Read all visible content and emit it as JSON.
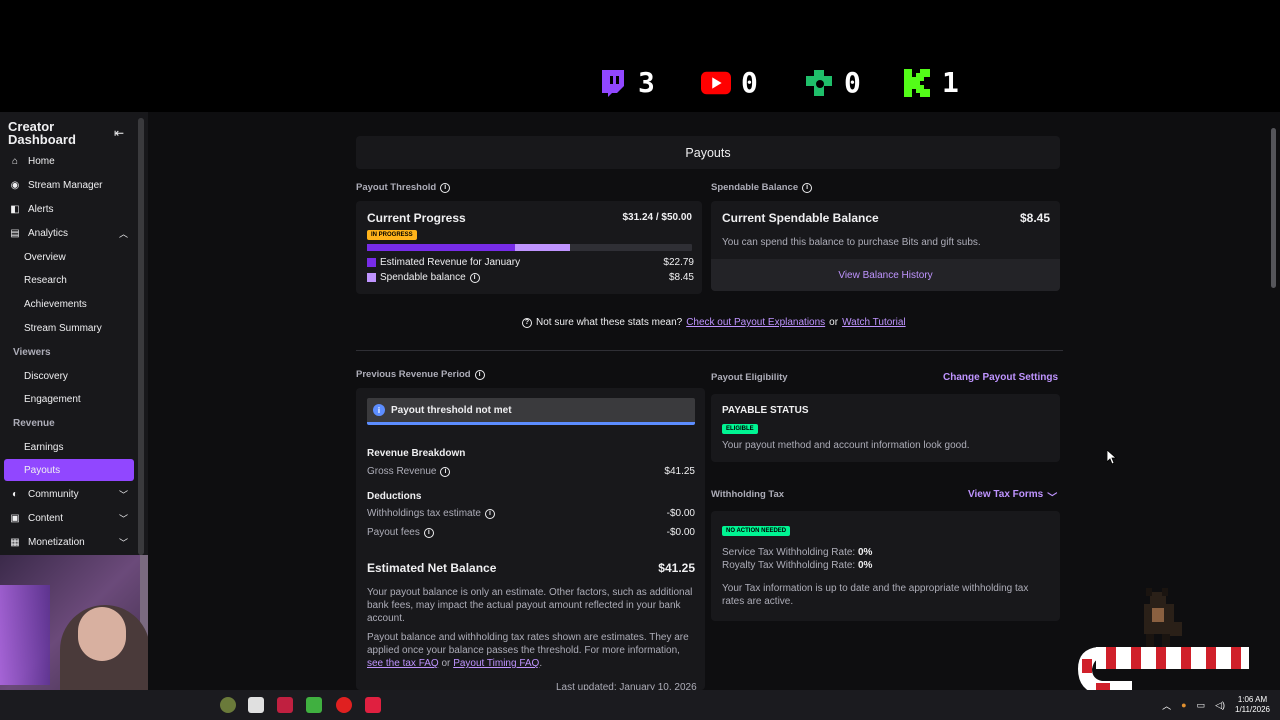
{
  "overlay": {
    "counters": [
      {
        "platform": "twitch-icon",
        "count": "3",
        "color": "#9147ff"
      },
      {
        "platform": "youtube-icon",
        "count": "0",
        "color": "#ff0000"
      },
      {
        "platform": "kick-alt-icon",
        "count": "0",
        "color": "#1fbf6a"
      },
      {
        "platform": "kick-icon",
        "count": "1",
        "color": "#53fc18"
      }
    ]
  },
  "sidebar": {
    "title": "Creator Dashboard",
    "items": [
      {
        "label": "Home",
        "icon": "home-icon"
      },
      {
        "label": "Stream Manager",
        "icon": "broadcast-icon"
      },
      {
        "label": "Alerts",
        "icon": "alerts-icon"
      },
      {
        "label": "Analytics",
        "icon": "analytics-icon"
      },
      {
        "label": "Overview"
      },
      {
        "label": "Research"
      },
      {
        "label": "Achievements"
      },
      {
        "label": "Stream Summary"
      },
      {
        "label": "Viewers"
      },
      {
        "label": "Discovery"
      },
      {
        "label": "Engagement"
      },
      {
        "label": "Revenue"
      },
      {
        "label": "Earnings"
      },
      {
        "label": "Payouts"
      },
      {
        "label": "Community",
        "icon": "community-icon"
      },
      {
        "label": "Content",
        "icon": "content-icon"
      },
      {
        "label": "Monetization",
        "icon": "monetization-icon"
      }
    ]
  },
  "main": {
    "page_title": "Payouts",
    "payout_threshold": {
      "label": "Payout Threshold",
      "heading": "Current Progress",
      "amount": "$31.24 / $50.00",
      "status_badge": "IN PROGRESS",
      "progress_revenue_fraction": 0.455,
      "progress_spendable_fraction": 0.169,
      "legend": [
        {
          "label": "Estimated Revenue for January",
          "value": "$22.79",
          "color": "#772ce8"
        },
        {
          "label": "Spendable balance",
          "value": "$8.45",
          "color": "#bf94ff"
        }
      ]
    },
    "spendable_balance": {
      "label": "Spendable Balance",
      "heading": "Current Spendable Balance",
      "amount": "$8.45",
      "description": "You can spend this balance to purchase Bits and gift subs.",
      "button": "View Balance History"
    },
    "help": {
      "prefix": "Not sure what these stats mean?",
      "link1": "Check out Payout Explanations",
      "or": "or",
      "link2": "Watch Tutorial"
    },
    "previous_period": {
      "label": "Previous Revenue Period",
      "alert": "Payout threshold not met",
      "breakdown_title": "Revenue Breakdown",
      "gross_label": "Gross Revenue",
      "gross_value": "$41.25",
      "deductions_title": "Deductions",
      "withholding_label": "Withholdings tax estimate",
      "withholding_value": "-$0.00",
      "fees_label": "Payout fees",
      "fees_value": "-$0.00",
      "net_label": "Estimated Net Balance",
      "net_value": "$41.25",
      "note1": "Your payout balance is only an estimate. Other factors, such as additional bank fees, may impact the actual payout amount reflected in your bank account.",
      "note2_prefix": "Payout balance and withholding tax rates shown are estimates. They are applied once your balance passes the threshold. For more information,",
      "note2_link1": "see the tax FAQ",
      "note2_or": "or",
      "note2_link2": "Payout Timing FAQ",
      "last_updated": "Last updated: January 10, 2026"
    },
    "eligibility": {
      "label": "Payout Eligibility",
      "action": "Change Payout Settings",
      "status_title": "PAYABLE STATUS",
      "badge": "ELIGIBLE",
      "description": "Your payout method and account information look good."
    },
    "withholding": {
      "label": "Withholding Tax",
      "action": "View Tax Forms",
      "badge": "NO ACTION NEEDED",
      "service_label": "Service Tax Withholding Rate:",
      "service_value": "0%",
      "royalty_label": "Royalty Tax Withholding Rate:",
      "royalty_value": "0%",
      "description": "Your Tax information is up to date and the appropriate withholding tax rates are active."
    }
  },
  "taskbar": {
    "time": "1:06 AM",
    "date": "1/11/2026"
  },
  "colors": {
    "accent": "#9147ff",
    "bg": "#0e0e10",
    "card": "#18181b",
    "eligible": "#00f593",
    "in_progress": "#ffb31a"
  }
}
